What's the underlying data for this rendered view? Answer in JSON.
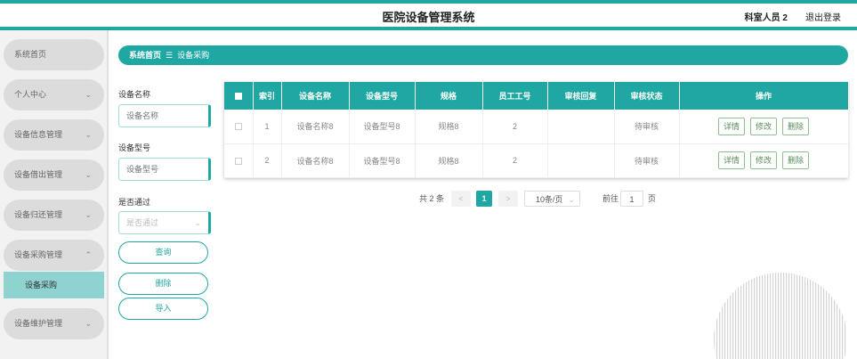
{
  "header": {
    "title": "医院设备管理系统",
    "user": "科室人员 2",
    "logout": "退出登录"
  },
  "sidebar": {
    "items": [
      {
        "label": "系统首页",
        "chevron": ""
      },
      {
        "label": "个人中心",
        "chevron": "⌄"
      },
      {
        "label": "设备信息管理",
        "chevron": "⌄"
      },
      {
        "label": "设备借出管理",
        "chevron": "⌄"
      },
      {
        "label": "设备归还管理",
        "chevron": "⌄"
      },
      {
        "label": "设备采购管理",
        "chevron": "⌃"
      },
      {
        "label": "设备维护管理",
        "chevron": "⌄"
      }
    ],
    "active_sub": "设备采购"
  },
  "breadcrumb": {
    "home": "系统首页",
    "sep": "☰",
    "current": "设备采购"
  },
  "filters": {
    "name_label": "设备名称",
    "name_placeholder": "设备名称",
    "model_label": "设备型号",
    "model_placeholder": "设备型号",
    "pass_label": "是否通过",
    "pass_placeholder": "是否通过",
    "query_btn": "查询",
    "delete_btn": "删除",
    "import_btn": "导入"
  },
  "table": {
    "headers": [
      "索引",
      "设备名称",
      "设备型号",
      "规格",
      "员工工号",
      "审核回复",
      "审核状态",
      "操作"
    ],
    "rows": [
      {
        "index": "1",
        "name": "设备名称8",
        "model": "设备型号8",
        "spec": "规格8",
        "staff": "2",
        "reply": "",
        "status": "待审核"
      },
      {
        "index": "2",
        "name": "设备名称8",
        "model": "设备型号8",
        "spec": "规格8",
        "staff": "2",
        "reply": "",
        "status": "待审核"
      }
    ],
    "actions": {
      "detail": "详情",
      "edit": "修改",
      "delete": "删除"
    }
  },
  "pager": {
    "total": "共 2 条",
    "prev": "<",
    "page": "1",
    "next": ">",
    "size": "10条/页",
    "goto": "前往",
    "goto_value": "1",
    "page_unit": "页"
  },
  "colors": {
    "accent": "#1fa8a3",
    "sub_active": "#8fd3d0"
  }
}
